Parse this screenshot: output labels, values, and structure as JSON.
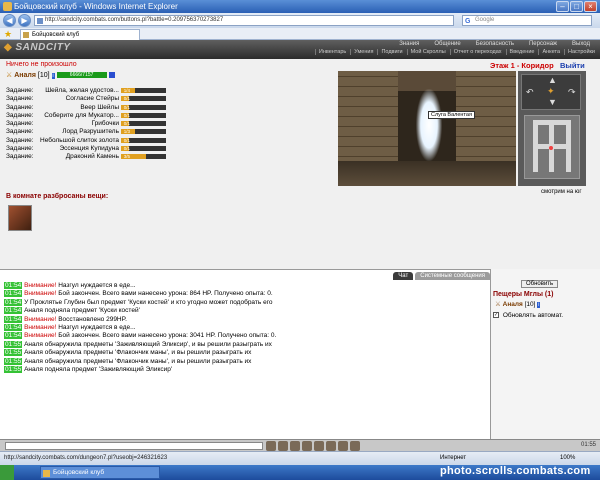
{
  "window": {
    "title": "Бойцовский клуб - Windows Internet Explorer"
  },
  "browser": {
    "address": "http://sandcity.combats.com/buttons.pl?battle=0.209756370273827",
    "search_placeholder": "Google",
    "tab_label": "Бойцовский клуб",
    "status_url": "http://sandcity.combats.com/dungeon7.pl?useobj=246321623",
    "zone": "Интернет",
    "zoom": "100%"
  },
  "header": {
    "logo": "SANDCITY",
    "menu": [
      "Знания",
      "Общение",
      "Безопасность",
      "Персонаж",
      "Выход"
    ],
    "submenu": [
      "Инвентарь",
      "Умения",
      "Подвиги",
      "Мой Скроллы",
      "Отчет о переходах",
      "Введение",
      "Анкета",
      "Настройки"
    ]
  },
  "status": {
    "error": "Ничего не произошло"
  },
  "character": {
    "name": "Аналя",
    "level": "[10]",
    "hp": "6666/7157"
  },
  "quests_label": "Задание:",
  "quests": [
    {
      "name": "Шейла, желая удостов...",
      "progress": 0.3,
      "count": "1/4"
    },
    {
      "name": "Согласие Стейры",
      "progress": 0.18,
      "count": "0/1"
    },
    {
      "name": "Веер Шейлы",
      "progress": 0.18,
      "count": "0/1"
    },
    {
      "name": "Соберите для Мукатор...",
      "progress": 0.18,
      "count": "0/1"
    },
    {
      "name": "Грибочки",
      "progress": 0.18,
      "count": "0/1"
    },
    {
      "name": "Лорд Разрушитель",
      "progress": 0.3,
      "count": "1/3"
    },
    {
      "name": "Небольшой слиток золота",
      "progress": 0.18,
      "count": "0/1"
    },
    {
      "name": "Эссенция Купидуна",
      "progress": 0.18,
      "count": "0/1"
    },
    {
      "name": "Драконий Камень",
      "progress": 0.55,
      "count": "3/5"
    }
  ],
  "items_header": "В комнате разбросаны вещи:",
  "location": {
    "title": "Этаж 1 - Коридор",
    "exit": "Выйти"
  },
  "npc_label": "Слуга Валентая",
  "look_direction": "смотрим на юг",
  "chat_tabs": [
    "Чат",
    "Системные сообщения"
  ],
  "chat": [
    {
      "time": "01:54",
      "alert": "Внимание!",
      "text": "Назгул нуждается в еде..."
    },
    {
      "time": "01:54",
      "alert": "Внимание!",
      "text": "Бой закончен. Всего вами нанесено урона: 864 HP. Получено опыта: 0."
    },
    {
      "time": "01:54",
      "alert": "",
      "text": "У Проклятье Глубин был предмет 'Куски костей' и кто угодно может подобрать его"
    },
    {
      "time": "01:54",
      "alert": "",
      "text": "Аналя подняла предмет 'Куски костей'"
    },
    {
      "time": "01:54",
      "alert": "Внимание!",
      "text": "Восстановлено 299HP."
    },
    {
      "time": "01:54",
      "alert": "Внимание!",
      "text": "Назгул нуждается в еде..."
    },
    {
      "time": "01:54",
      "alert": "Внимание!",
      "text": "Бой закончен. Всего вами нанесено урона: 3041 HP. Получено опыта: 0."
    },
    {
      "time": "01:55",
      "alert": "",
      "text": "Аналя обнаружила предметы 'Заживляющий Эликсир', и вы решили разыграть их"
    },
    {
      "time": "01:55",
      "alert": "",
      "text": "Аналя обнаружила предметы 'Флакончик маны', и вы решили разыграть их"
    },
    {
      "time": "01:55",
      "alert": "",
      "text": "Аналя обнаружила предметы 'Флакончик маны', и вы решили разыграть их"
    },
    {
      "time": "01:55",
      "alert": "",
      "text": "Аналя подняла предмет 'Заживляющий Эликсир'"
    }
  ],
  "side": {
    "refresh_label": "Обновить",
    "cave": "Пещеры Мглы (1)",
    "player": "Аналя",
    "player_level": "[10]",
    "auto_refresh": "Обновлять автомат."
  },
  "clock": "01:55",
  "watermark": "photo.scrolls.combats.com",
  "colors": {
    "alert": "#cc0000",
    "time_bg": "#35c235",
    "name": "#7a3b00"
  }
}
